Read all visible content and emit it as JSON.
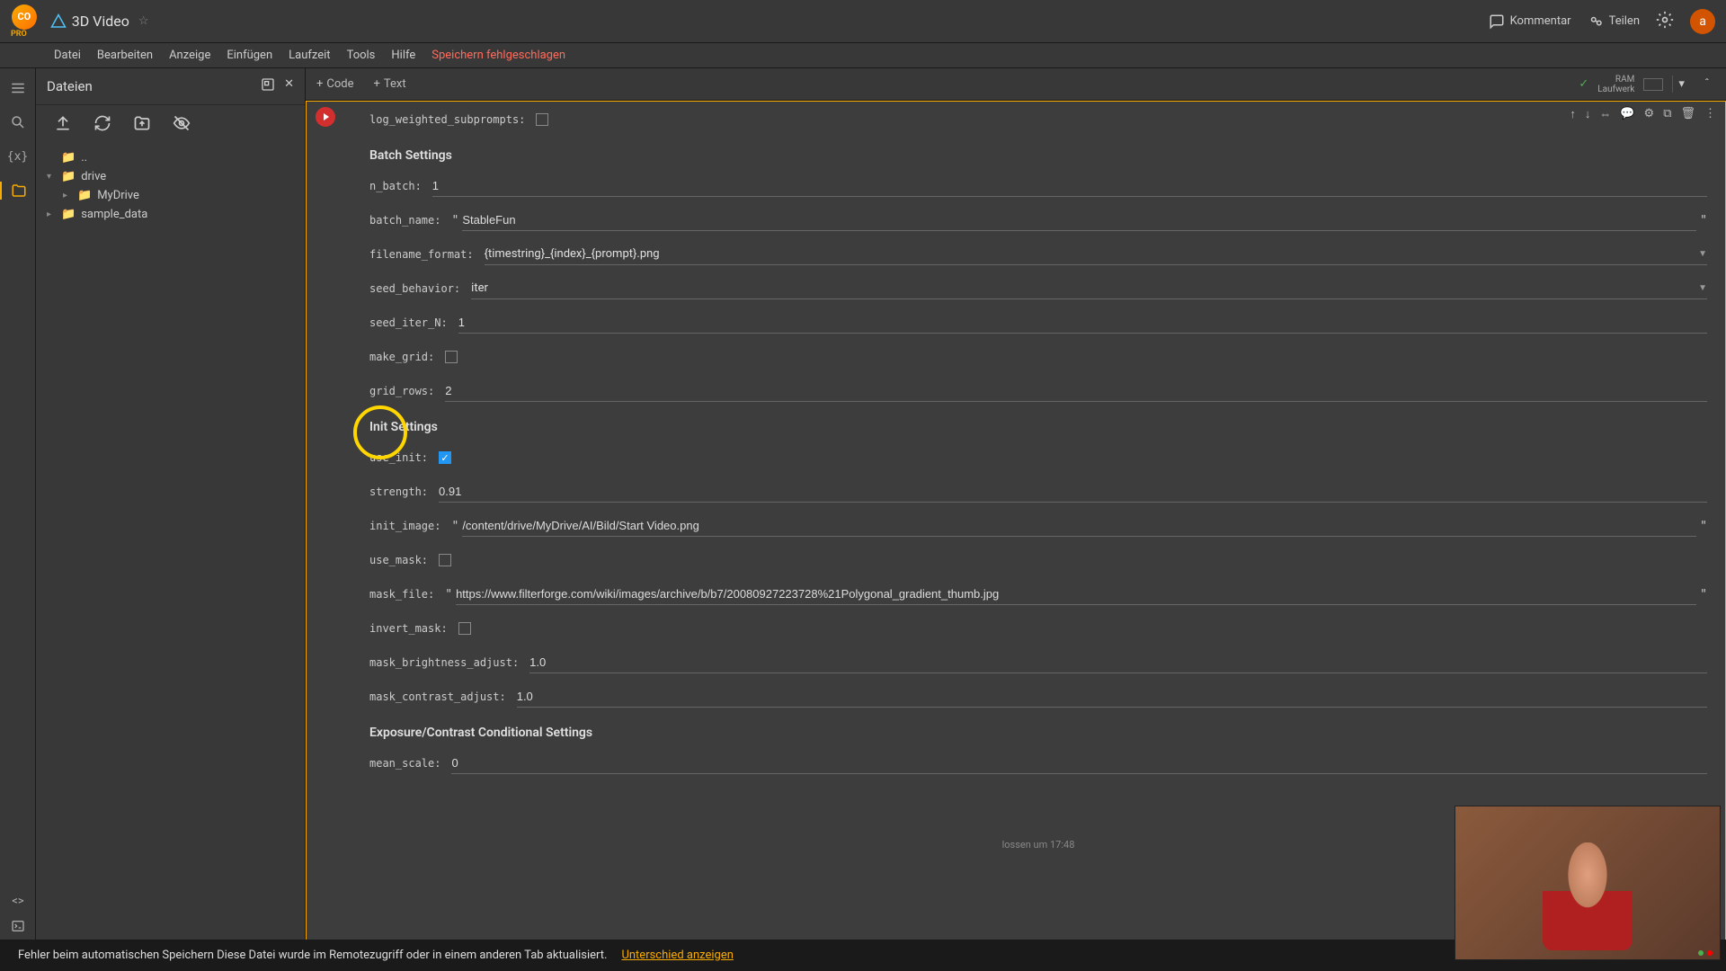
{
  "header": {
    "pro": "PRO",
    "title": "3D Video",
    "comment": "Kommentar",
    "share": "Teilen",
    "avatar_letter": "a"
  },
  "menu": {
    "items": [
      "Datei",
      "Bearbeiten",
      "Anzeige",
      "Einfügen",
      "Laufzeit",
      "Tools",
      "Hilfe"
    ],
    "save_status": "Speichern fehlgeschlagen"
  },
  "sidebar": {
    "title": "Dateien",
    "tree": {
      "up": "..",
      "drive": "drive",
      "mydrive": "MyDrive",
      "sample_data": "sample_data"
    }
  },
  "toolbar": {
    "code": "Code",
    "text": "Text",
    "ram_label": "RAM",
    "runtime_label": "Laufwerk"
  },
  "form": {
    "log_weighted_subprompts": {
      "label": "log_weighted_subprompts:"
    },
    "batch_header": "Batch Settings",
    "n_batch": {
      "label": "n_batch:",
      "value": "1"
    },
    "batch_name": {
      "label": "batch_name:",
      "value": "StableFun"
    },
    "filename_format": {
      "label": "filename_format:",
      "value": "{timestring}_{index}_{prompt}.png"
    },
    "seed_behavior": {
      "label": "seed_behavior:",
      "value": "iter"
    },
    "seed_iter_N": {
      "label": "seed_iter_N:",
      "value": "1"
    },
    "make_grid": {
      "label": "make_grid:"
    },
    "grid_rows": {
      "label": "grid_rows:",
      "value": "2"
    },
    "init_header": "Init Settings",
    "use_init": {
      "label": "use_init:"
    },
    "strength": {
      "label": "strength:",
      "value": "0.91"
    },
    "init_image": {
      "label": "init_image:",
      "value": "/content/drive/MyDrive/AI/Bild/Start Video.png"
    },
    "use_mask": {
      "label": "use_mask:"
    },
    "mask_file": {
      "label": "mask_file:",
      "value": "https://www.filterforge.com/wiki/images/archive/b/b7/20080927223728%21Polygonal_gradient_thumb.jpg"
    },
    "invert_mask": {
      "label": "invert_mask:"
    },
    "mask_brightness_adjust": {
      "label": "mask_brightness_adjust:",
      "value": "1.0"
    },
    "mask_contrast_adjust": {
      "label": "mask_contrast_adjust:",
      "value": "1.0"
    },
    "exposure_header": "Exposure/Contrast Conditional Settings",
    "mean_scale": {
      "label": "mean_scale:",
      "value": "0"
    }
  },
  "warning": {
    "text": "Fehler beim automatischen Speichern Diese Datei wurde im Remotezugriff oder in einem anderen Tab aktualisiert.",
    "link": "Unterschied anzeigen"
  },
  "footer_partial": "lossen um 17:48"
}
